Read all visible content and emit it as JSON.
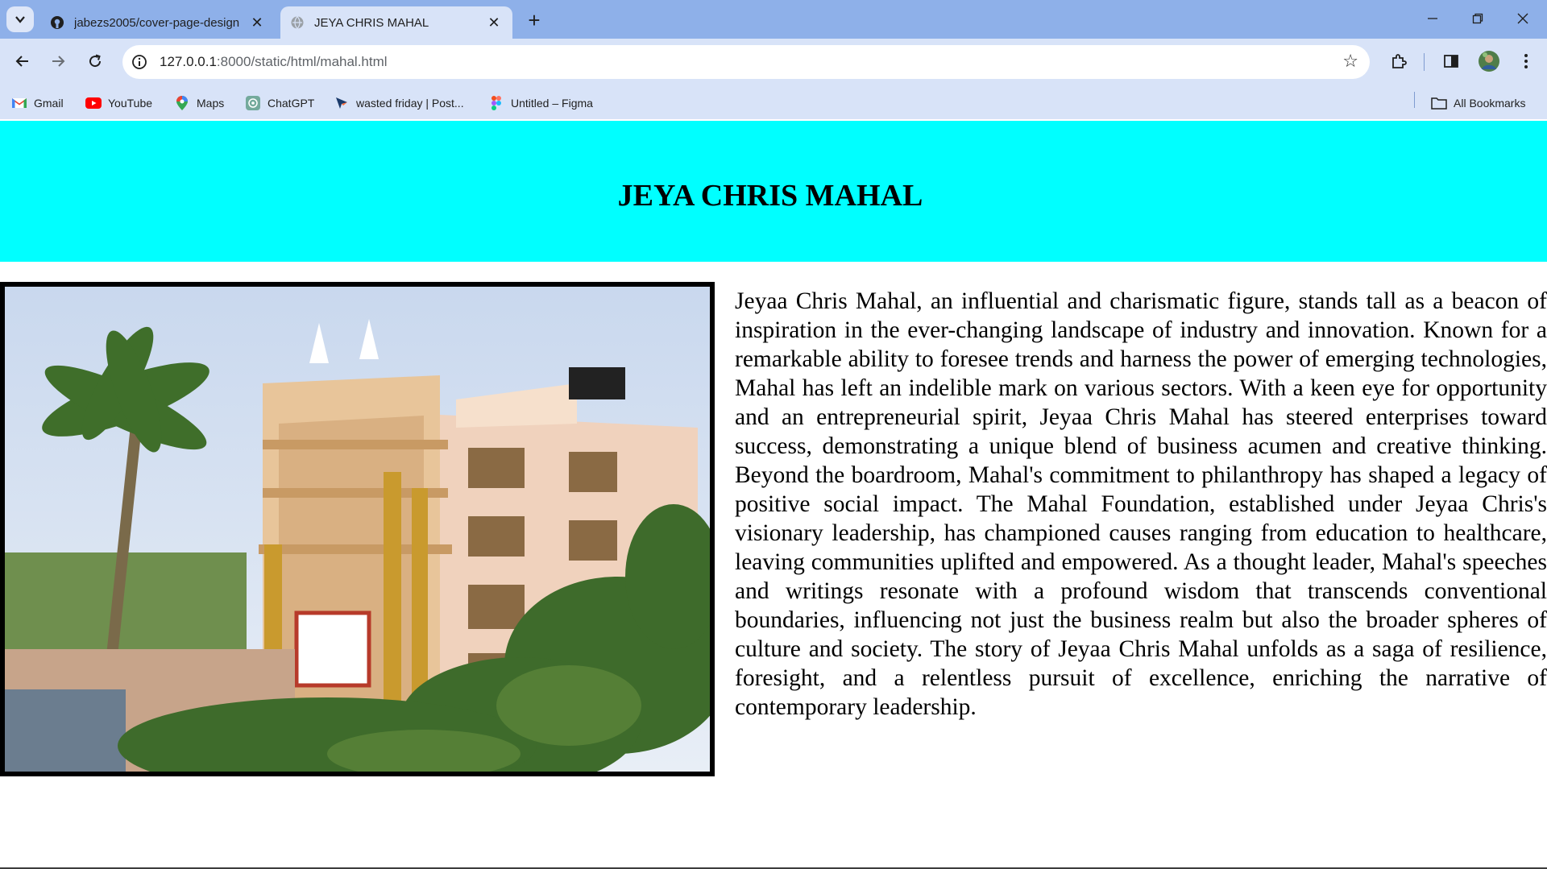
{
  "browser": {
    "tabs": [
      {
        "title": "jabezs2005/cover-page-design",
        "icon": "github-icon",
        "active": false
      },
      {
        "title": "JEYA CHRIS MAHAL",
        "icon": "globe-icon",
        "active": true
      }
    ],
    "address_bar": {
      "host": "127.0.0.1",
      "path": ":8000/static/html/mahal.html"
    },
    "bookmarks": [
      {
        "label": "Gmail",
        "icon": "gmail-icon"
      },
      {
        "label": "YouTube",
        "icon": "youtube-icon"
      },
      {
        "label": "Maps",
        "icon": "maps-icon"
      },
      {
        "label": "ChatGPT",
        "icon": "chatgpt-icon"
      },
      {
        "label": "wasted friday | Post...",
        "icon": "postman-icon"
      },
      {
        "label": "Untitled – Figma",
        "icon": "figma-icon"
      }
    ],
    "all_bookmarks_label": "All Bookmarks"
  },
  "page": {
    "header_title": "JEYA CHRIS MAHAL",
    "header_color": "#00ffff",
    "image_subject": "building-photo",
    "bio": "Jeyaa Chris Mahal, an influential and charismatic figure, stands tall as a beacon of inspiration in the ever-changing landscape of industry and innovation. Known for a remarkable ability to foresee trends and harness the power of emerging technologies, Mahal has left an indelible mark on various sectors. With a keen eye for opportunity and an entrepreneurial spirit, Jeyaa Chris Mahal has steered enterprises toward success, demonstrating a unique blend of business acumen and creative thinking. Beyond the boardroom, Mahal's commitment to philanthropy has shaped a legacy of positive social impact. The Mahal Foundation, established under Jeyaa Chris's visionary leadership, has championed causes ranging from education to healthcare, leaving communities uplifted and empowered. As a thought leader, Mahal's speeches and writings resonate with a profound wisdom that transcends conventional boundaries, influencing not just the business realm but also the broader spheres of culture and society. The story of Jeyaa Chris Mahal unfolds as a saga of resilience, foresight, and a relentless pursuit of excellence, enriching the narrative of contemporary leadership."
  }
}
